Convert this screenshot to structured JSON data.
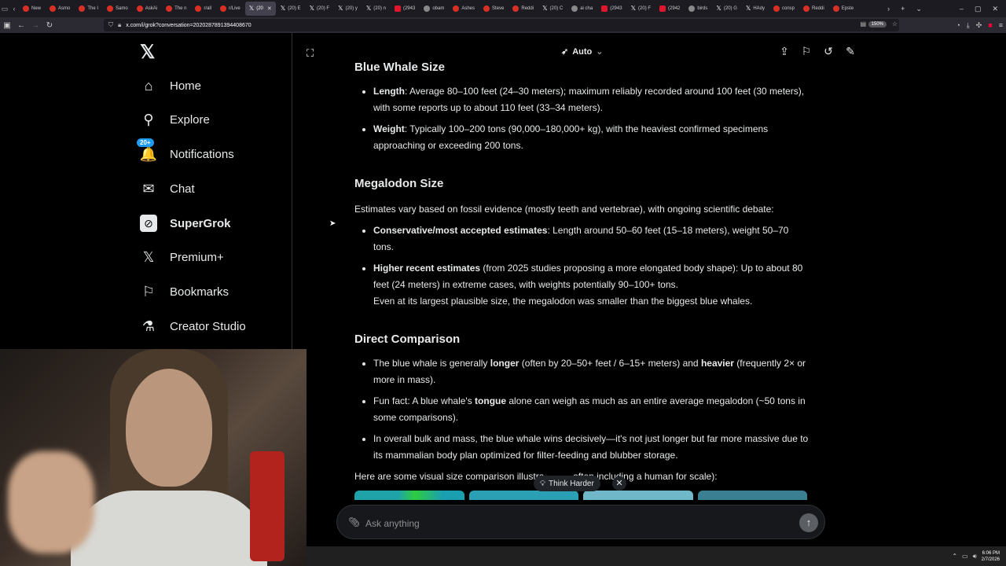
{
  "browser": {
    "tabs": [
      {
        "label": "New",
        "icon": "newtab-icon",
        "active": false
      },
      {
        "label": "Asmo",
        "icon": "reddit-icon",
        "active": false
      },
      {
        "label": "The I",
        "icon": "reddit-icon",
        "active": false
      },
      {
        "label": "Samo",
        "icon": "reddit-icon",
        "active": false
      },
      {
        "label": "AskAi",
        "icon": "reddit-icon",
        "active": false
      },
      {
        "label": "The n",
        "icon": "reddit-icon",
        "active": false
      },
      {
        "label": "r/all",
        "icon": "reddit-icon",
        "active": false
      },
      {
        "label": "r/Live",
        "icon": "reddit-icon",
        "active": false
      },
      {
        "label": "(20",
        "icon": "x-icon",
        "active": true
      },
      {
        "label": "(20) E",
        "icon": "x-icon",
        "active": false
      },
      {
        "label": "(20) F",
        "icon": "x-icon",
        "active": false
      },
      {
        "label": "(20) y",
        "icon": "x-icon",
        "active": false
      },
      {
        "label": "(20) n",
        "icon": "x-icon",
        "active": false
      },
      {
        "label": "(2943",
        "icon": "youtube-icon",
        "active": false
      },
      {
        "label": "obam",
        "icon": "globe-icon",
        "active": false
      },
      {
        "label": "Ashes",
        "icon": "reddit-icon",
        "active": false
      },
      {
        "label": "Steve",
        "icon": "reddit-icon",
        "active": false
      },
      {
        "label": "Reddi",
        "icon": "reddit-icon",
        "active": false
      },
      {
        "label": "(20) C",
        "icon": "x-icon",
        "active": false
      },
      {
        "label": "ai cha",
        "icon": "globe-icon",
        "active": false
      },
      {
        "label": "(2943",
        "icon": "youtube-icon",
        "active": false
      },
      {
        "label": "(20) F",
        "icon": "x-icon",
        "active": false
      },
      {
        "label": "(2942",
        "icon": "youtube-icon",
        "active": false
      },
      {
        "label": "birds",
        "icon": "globe-icon",
        "active": false
      },
      {
        "label": "(20) G",
        "icon": "x-icon",
        "active": false
      },
      {
        "label": "HAdy",
        "icon": "x-icon",
        "active": false
      },
      {
        "label": "consp",
        "icon": "reddit-icon",
        "active": false
      },
      {
        "label": "Reddi",
        "icon": "reddit-icon",
        "active": false
      },
      {
        "label": "Epste",
        "icon": "reddit-icon",
        "active": false
      }
    ],
    "url": "x.com/i/grok?conversation=2020287891394408670",
    "zoom": "150%"
  },
  "sidebar": {
    "items": [
      {
        "label": "Home",
        "icon": "home-icon",
        "glyph": "⌂",
        "badge": ""
      },
      {
        "label": "Explore",
        "icon": "search-icon",
        "glyph": "⚲",
        "badge": ""
      },
      {
        "label": "Notifications",
        "icon": "bell-icon",
        "glyph": "🔔",
        "badge": "20+"
      },
      {
        "label": "Chat",
        "icon": "mail-icon",
        "glyph": "✉",
        "badge": ""
      },
      {
        "label": "SuperGrok",
        "icon": "grok-icon",
        "glyph": "⊘",
        "badge": ""
      },
      {
        "label": "Premium+",
        "icon": "x-icon",
        "glyph": "𝕏",
        "badge": ""
      },
      {
        "label": "Bookmarks",
        "icon": "bookmark-icon",
        "glyph": "⚐",
        "badge": ""
      },
      {
        "label": "Creator Studio",
        "icon": "flask-icon",
        "glyph": "⚗",
        "badge": ""
      }
    ]
  },
  "header": {
    "mode_label": "Auto"
  },
  "content": {
    "blue_whale": {
      "title": "Blue Whale Size",
      "length_label": "Length",
      "length_text": ": Average 80–100 feet (24–30 meters); maximum reliably recorded around 100 feet (30 meters), with some reports up to about 110 feet (33–34 meters).",
      "weight_label": "Weight",
      "weight_text": ": Typically 100–200 tons (90,000–180,000+ kg), with the heaviest confirmed specimens approaching or exceeding 200 tons."
    },
    "megalodon": {
      "title": "Megalodon Size",
      "intro": "Estimates vary based on fossil evidence (mostly teeth and vertebrae), with ongoing scientific debate:",
      "conservative_label": "Conservative/most accepted estimates",
      "conservative_text": ": Length around 50–60 feet (15–18 meters), weight 50–70 tons.",
      "higher_label": "Higher recent estimates",
      "higher_text": " (from 2025 studies proposing a more elongated body shape): Up to about 80 feet (24 meters) in extreme cases, with weights potentially 90–100+ tons.",
      "note": "Even at its largest plausible size, the megalodon was smaller than the biggest blue whales."
    },
    "comparison": {
      "title": "Direct Comparison",
      "item1_pre": "The blue whale is generally ",
      "item1_b1": "longer",
      "item1_mid": " (often by 20–50+ feet / 6–15+ meters) and ",
      "item1_b2": "heavier",
      "item1_post": " (frequently 2× or more in mass).",
      "item2_pre": "Fun fact: A blue whale's ",
      "item2_b": "tongue",
      "item2_post": " alone can weigh as much as an entire average megalodon (~50 tons in some comparisons).",
      "item3": "In overall bulk and mass, the blue whale wins decisively—it's not just longer but far more massive due to its mammalian body plan optimized for filter-feeding and blubber storage."
    },
    "visual_intro": "Here are some visual size comparison illustra           often including a human for scale):"
  },
  "think_harder_label": "Think Harder",
  "input": {
    "placeholder": "Ask anything"
  },
  "colors": {
    "accent": "#1d9bf0",
    "background": "#000000",
    "text": "#e7e9ea",
    "border": "#2f3336"
  },
  "taskbar": {
    "time": "6:06 PM",
    "date": "2/7/2026"
  }
}
